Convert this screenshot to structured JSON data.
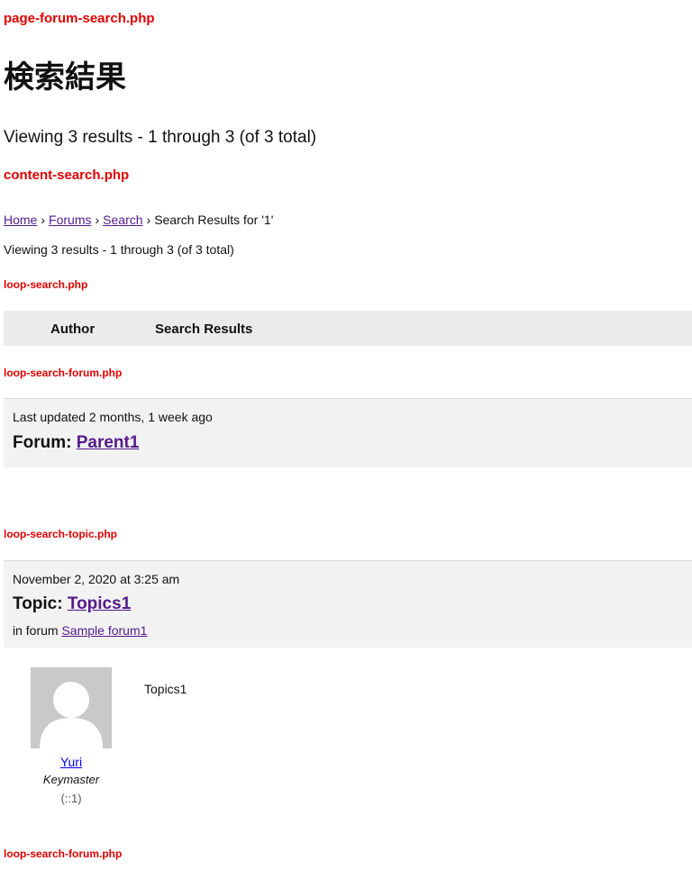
{
  "templates": {
    "page": "page-forum-search.php",
    "content": "content-search.php",
    "loop": "loop-search.php",
    "loop_forum": "loop-search-forum.php",
    "loop_topic": "loop-search-topic.php"
  },
  "page_title": "検索結果",
  "summary": "Viewing 3 results - 1 through 3 (of 3 total)",
  "breadcrumb": {
    "home": "Home",
    "sep": "›",
    "forums": "Forums",
    "search": "Search",
    "current": "Search Results for '1'"
  },
  "results_header": {
    "author": "Author",
    "results": "Search Results"
  },
  "forum_result": {
    "updated": "Last updated 2 months, 1 week ago",
    "title_prefix": "Forum:",
    "title_link": "Parent1"
  },
  "topic_result": {
    "date": "November 2, 2020 at 3:25 am",
    "title_prefix": "Topic:",
    "title_link": "Topics1",
    "in_forum_prefix": "in forum",
    "forum_link": "Sample forum1",
    "author_name": "Yuri",
    "author_role": "Keymaster",
    "author_ip": "(::1)",
    "content": "Topics1"
  },
  "colors": {
    "template_label": "#e00000",
    "visited_link": "#551a8b",
    "link": "#0000ee",
    "header_bg": "#ebebeb",
    "item_head_bg": "#f2f2f2",
    "avatar_bg": "#c9c9c9"
  },
  "icons": {
    "avatar": "default-user-avatar-icon"
  }
}
